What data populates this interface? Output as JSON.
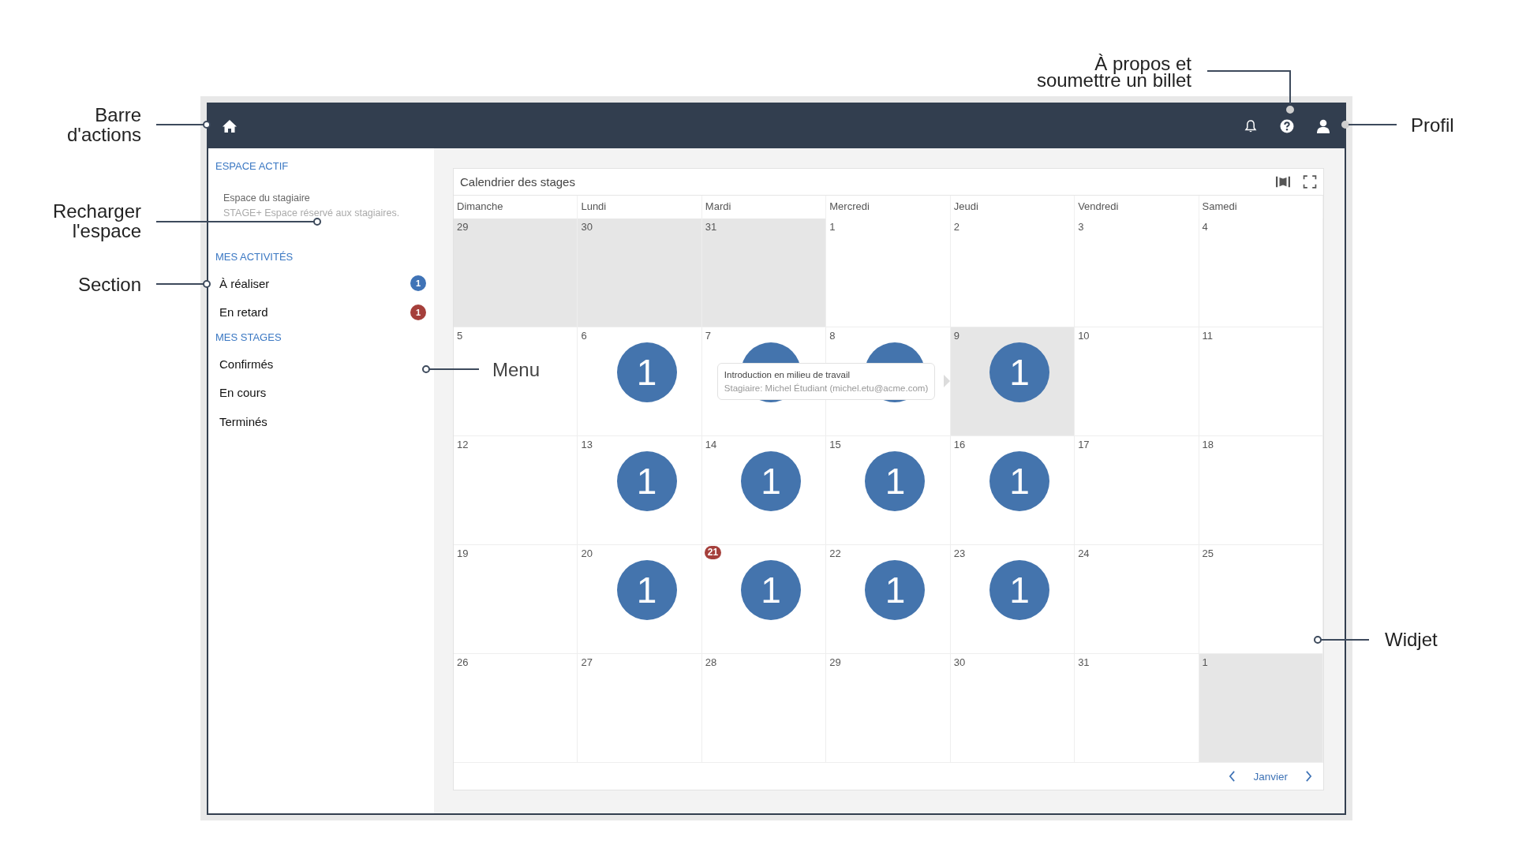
{
  "annotations": [
    {
      "lines": [
        "Barre",
        "d'actions"
      ]
    },
    {
      "lines": [
        "Recharger",
        "l'espace"
      ]
    },
    {
      "lines": [
        "Section"
      ]
    },
    {
      "lines": [
        "Menu"
      ]
    },
    {
      "lines": [
        "À propos et",
        "soumettre un billet"
      ]
    },
    {
      "lines": [
        "Profil"
      ]
    },
    {
      "lines": [
        "Widjet"
      ]
    }
  ],
  "sidebar": {
    "sections": [
      {
        "heading": "ESPACE ACTIF",
        "kind": "space",
        "title": "Espace du stagiaire",
        "subtitle": "STAGE+ Espace réservé aux stagiaires."
      },
      {
        "heading": "MES ACTIVITÉS",
        "kind": "list",
        "items": [
          {
            "label": "À réaliser",
            "badge": "1",
            "color": "#3f73b6"
          },
          {
            "label": "En retard",
            "badge": "1",
            "color": "#a53f3b"
          }
        ]
      },
      {
        "heading": "MES STAGES",
        "kind": "list",
        "items": [
          {
            "label": "Confirmés"
          },
          {
            "label": "En cours"
          },
          {
            "label": "Terminés"
          }
        ]
      }
    ]
  },
  "widget": {
    "title": "Calendrier des stages",
    "days": [
      "Dimanche",
      "Lundi",
      "Mardi",
      "Mercredi",
      "Jeudi",
      "Vendredi",
      "Samedi"
    ],
    "weeks": [
      [
        {
          "day": "29",
          "shaded": true
        },
        {
          "day": "30",
          "shaded": true
        },
        {
          "day": "31",
          "shaded": true
        },
        {
          "day": "1",
          "shaded": false
        },
        {
          "day": "2",
          "shaded": false
        },
        {
          "day": "3",
          "shaded": false
        },
        {
          "day": "4",
          "shaded": false
        }
      ],
      [
        {
          "day": "5",
          "shaded": false
        },
        {
          "day": "6",
          "shaded": false,
          "event": "1"
        },
        {
          "day": "7",
          "shaded": false,
          "marker": true,
          "tooltip": {
            "title": "Introduction en milieu de travail",
            "subtitle": "Stagiaire: Michel Étudiant (michel.etu@acme.com)"
          }
        },
        {
          "day": "8",
          "shaded": false,
          "marker": true
        },
        {
          "day": "9",
          "shaded": true,
          "event": "1"
        },
        {
          "day": "10",
          "shaded": false
        },
        {
          "day": "11",
          "shaded": false
        }
      ],
      [
        {
          "day": "12",
          "shaded": false
        },
        {
          "day": "13",
          "shaded": false,
          "event": "1"
        },
        {
          "day": "14",
          "shaded": false,
          "event": "1"
        },
        {
          "day": "15",
          "shaded": false,
          "event": "1"
        },
        {
          "day": "16",
          "shaded": false,
          "event": "1"
        },
        {
          "day": "17",
          "shaded": false
        },
        {
          "day": "18",
          "shaded": false
        }
      ],
      [
        {
          "day": "19",
          "shaded": false
        },
        {
          "day": "20",
          "shaded": false,
          "event": "1"
        },
        {
          "day": "21",
          "shaded": false,
          "today": true,
          "event": "1"
        },
        {
          "day": "22",
          "shaded": false,
          "event": "1"
        },
        {
          "day": "23",
          "shaded": false,
          "event": "1"
        },
        {
          "day": "24",
          "shaded": false
        },
        {
          "day": "25",
          "shaded": false
        }
      ],
      [
        {
          "day": "26",
          "shaded": false
        },
        {
          "day": "27",
          "shaded": false
        },
        {
          "day": "28",
          "shaded": false
        },
        {
          "day": "29",
          "shaded": false
        },
        {
          "day": "30",
          "shaded": false
        },
        {
          "day": "31",
          "shaded": false
        },
        {
          "day": "1",
          "shaded": true
        }
      ]
    ],
    "month": "Janvier"
  }
}
